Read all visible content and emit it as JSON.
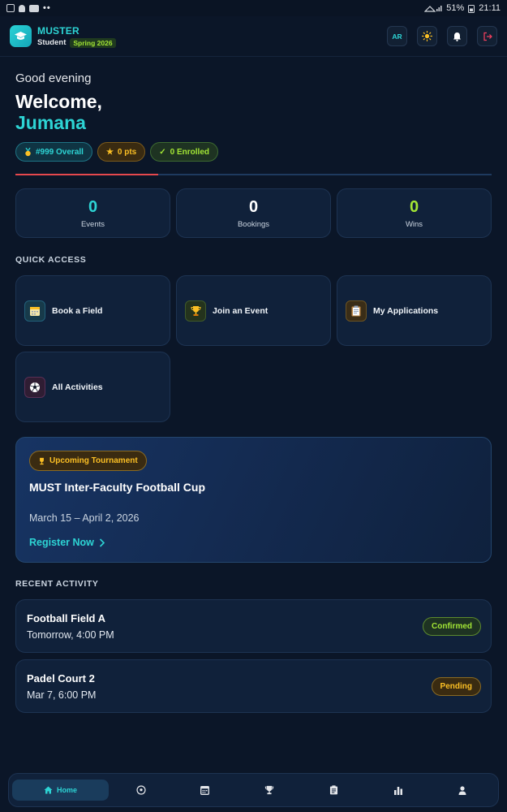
{
  "statusbar": {
    "battery": "51%",
    "time": "21:11",
    "left_dots": "••"
  },
  "header": {
    "app_name": "MUSTER",
    "role": "Student",
    "term": "Spring 2026",
    "lang_button": "AR",
    "icons": [
      "theme-sun-icon",
      "bell-icon",
      "logout-icon"
    ]
  },
  "greeting": {
    "line": "Good evening",
    "welcome": "Welcome,",
    "name": "Jumana"
  },
  "pills": [
    {
      "icon": "medal-icon",
      "label": "#999 Overall"
    },
    {
      "icon": "star-icon",
      "label": "0 pts"
    },
    {
      "icon": "check-icon",
      "label": "0 Enrolled"
    }
  ],
  "progress": {
    "fraction": 0.3
  },
  "stats": [
    {
      "value": "0",
      "label": "Events",
      "color": "#2dd4d4"
    },
    {
      "value": "0",
      "label": "Bookings",
      "color": "#ffffff"
    },
    {
      "value": "0",
      "label": "Wins",
      "color": "#a3e635"
    }
  ],
  "quick_access": {
    "title": "QUICK ACCESS",
    "items": [
      {
        "label": "Book a Field",
        "icon": "calendar-icon"
      },
      {
        "label": "Join an Event",
        "icon": "trophy-icon"
      },
      {
        "label": "My Applications",
        "icon": "clipboard-icon"
      },
      {
        "label": "All Activities",
        "icon": "soccer-ball-icon"
      }
    ]
  },
  "tournament": {
    "badge": "Upcoming Tournament",
    "title": "MUST Inter-Faculty Football Cup",
    "dates": "March 15 – April 2, 2026",
    "cta": "Register Now"
  },
  "recent": {
    "title": "RECENT ACTIVITY",
    "items": [
      {
        "title": "Football Field A",
        "time": "Tomorrow, 4:00 PM",
        "status": "Confirmed"
      },
      {
        "title": "Padel Court 2",
        "time": "Mar 7, 6:00 PM",
        "status": "Pending"
      }
    ]
  },
  "bottom_nav": [
    {
      "label": "Home",
      "icon": "home-icon",
      "active": true
    },
    {
      "label": "",
      "icon": "soccer-ball-icon"
    },
    {
      "label": "",
      "icon": "calendar-icon"
    },
    {
      "label": "",
      "icon": "trophy-icon"
    },
    {
      "label": "",
      "icon": "clipboard-icon"
    },
    {
      "label": "",
      "icon": "bar-chart-icon"
    },
    {
      "label": "",
      "icon": "user-icon"
    }
  ]
}
